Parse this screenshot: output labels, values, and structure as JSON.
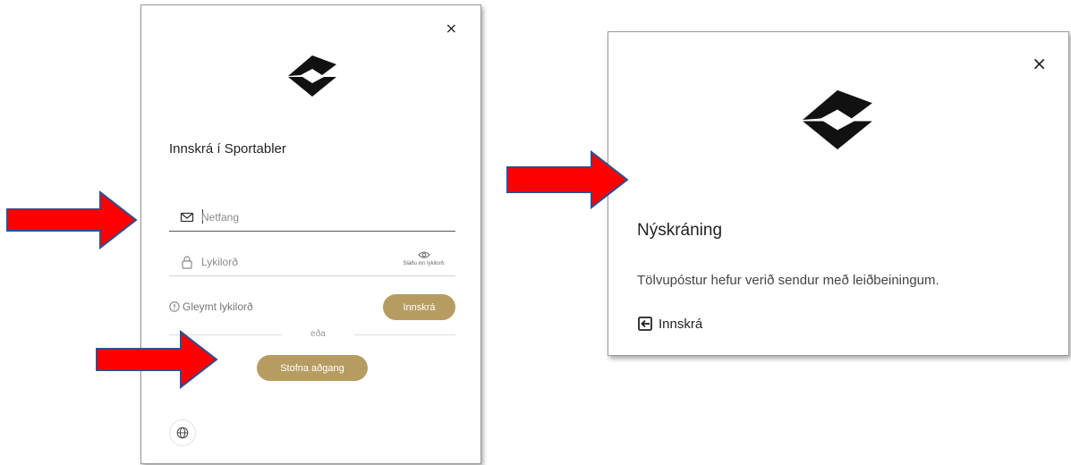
{
  "login_dialog": {
    "title": "Innskrá í Sportabler",
    "close_glyph": "×",
    "email_placeholder": "Netfang",
    "password_placeholder": "Lykilorð",
    "show_password_label": "Sláðu inn lykilorð.",
    "forgot_password": "Gleymt lykilorð",
    "login_button": "Innskrá",
    "or_text": "eða",
    "create_account_button": "Stofna aðgang"
  },
  "signup_dialog": {
    "close_glyph": "×",
    "title": "Nýskráning",
    "message": "Tölvupóstur hefur verið sendur með leiðbeiningum.",
    "signin_link": "Innskrá"
  },
  "colors": {
    "accent_gold": "#b79c62",
    "arrow_red": "#ff0000",
    "arrow_outline": "#2f4f8f"
  },
  "icons": [
    "close-icon",
    "sportabler-logo",
    "envelope-icon",
    "lock-icon",
    "eye-icon",
    "info-icon",
    "globe-icon",
    "login-icon",
    "red-arrow"
  ]
}
